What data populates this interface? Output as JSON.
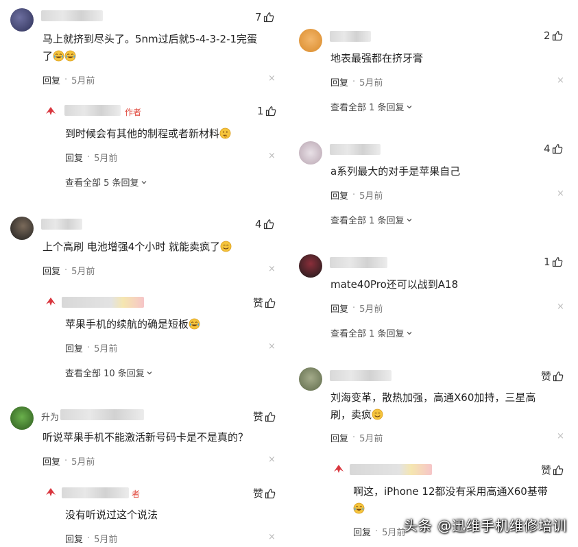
{
  "author_tag": "作者",
  "reply_label": "回复",
  "dot": "·",
  "close": "×",
  "colors": {
    "author": "#e0463a",
    "text": "#222222",
    "muted": "#777777"
  },
  "icons": {
    "like": "thumb-up-icon",
    "close": "close-icon",
    "chevron": "chevron-down-icon",
    "emoji_laugh_cry": "laugh-cry-emoji",
    "emoji_thinking": "thinking-emoji",
    "emoji_smile": "smile-emoji"
  },
  "left": [
    {
      "likes": "7",
      "text_l1": "马上就挤到尽头了。5nm过后就5-4-3-2-1完蛋",
      "text_l2": "了",
      "time": "5月前",
      "reply": {
        "likes": "1",
        "text": "到时候会有其他的制程或者新材料",
        "time": "5月前"
      },
      "view_more": "查看全部 5 条回复"
    },
    {
      "likes": "4",
      "text": "上个高刷 电池增强4个小时 就能卖疯了",
      "time": "5月前",
      "reply": {
        "likes": "赞",
        "text": "苹果手机的续航的确是短板",
        "time": "5月前"
      },
      "view_more": "查看全部 10 条回复"
    },
    {
      "likes": "赞",
      "name_fragment": "升为",
      "text": "听说苹果手机不能激活新号码卡是不是真的？",
      "time": "5月前",
      "reply": {
        "likes": "赞",
        "tag_fragment": "者",
        "text": "没有听说过这个说法",
        "time": "5月前"
      }
    }
  ],
  "right": [
    {
      "likes": "2",
      "text": "地表最强都在挤牙膏",
      "time": "5月前",
      "view_more": "查看全部 1 条回复"
    },
    {
      "likes": "4",
      "text": "a系列最大的对手是苹果自己",
      "time": "5月前",
      "view_more": "查看全部 1 条回复"
    },
    {
      "likes": "1",
      "text": "mate40Pro还可以战到A18",
      "time": "5月前",
      "view_more": "查看全部 1 条回复"
    },
    {
      "likes": "赞",
      "text_l1": "刘海变革，散热加强，高通X60加持，三星高",
      "text_l2": "刷，卖疯",
      "time": "5月前",
      "reply": {
        "likes": "赞",
        "text": "啊这，iPhone 12都没有采用高通X60基带",
        "time": "5月前"
      }
    }
  ],
  "watermark": "头条 @迅维手机维修培训"
}
